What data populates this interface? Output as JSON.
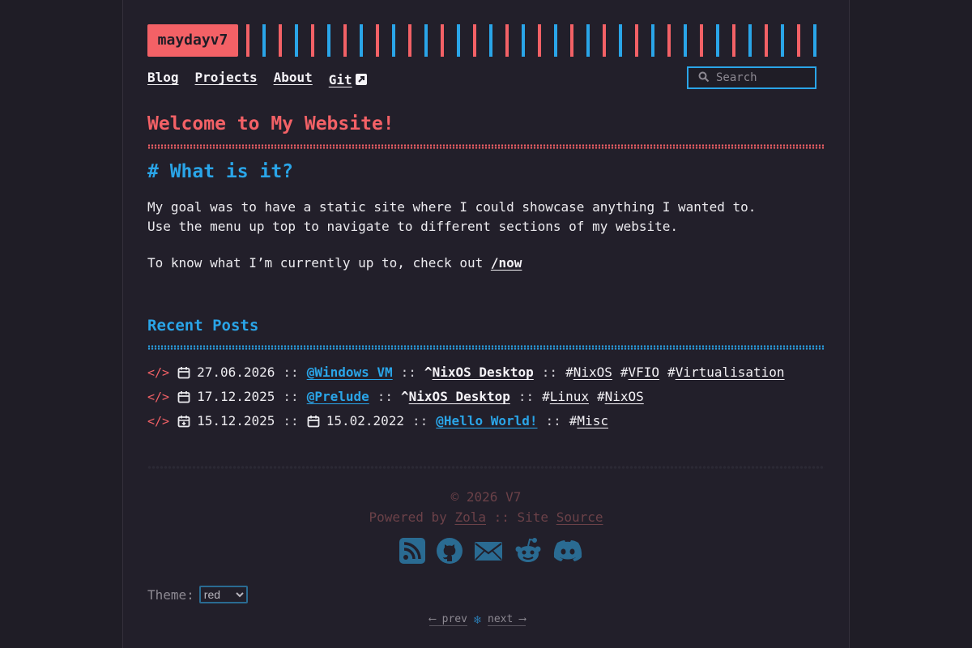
{
  "site": {
    "logo": "maydayv7"
  },
  "nav": {
    "items": [
      {
        "label": "Blog"
      },
      {
        "label": "Projects"
      },
      {
        "label": "About"
      },
      {
        "label": "Git"
      }
    ]
  },
  "search": {
    "placeholder": "Search"
  },
  "main": {
    "title": "Welcome to My Website!",
    "section_heading": "# What is it?",
    "para1_line1": "My goal was to have a static site where I could showcase anything I wanted to.",
    "para1_line2": "Use the menu up top to navigate to different sections of my website.",
    "para2_text": "To know what I’m currently up to, check out",
    "para2_link": "/now"
  },
  "recent": {
    "heading": "Recent Posts",
    "code_glyph": "</>",
    "sep": "::",
    "posts": [
      {
        "date": "27.06.2026",
        "title": "@Windows VM",
        "series": "NixOS Desktop",
        "tags": [
          "NixOS",
          "VFIO",
          "Virtualisation"
        ]
      },
      {
        "date": "17.12.2025",
        "title": "@Prelude",
        "series": "NixOS Desktop",
        "tags": [
          "Linux",
          "NixOS"
        ]
      },
      {
        "date": "15.12.2025",
        "updated": "15.02.2022",
        "title": "@Hello World!",
        "tags": [
          "Misc"
        ]
      }
    ]
  },
  "footer": {
    "copyright": "© 2026 V7",
    "powered_by": "Powered by",
    "zola": "Zola",
    "site": ":: Site",
    "source": "Source",
    "social_icons": [
      "rss-icon",
      "github-icon",
      "mail-icon",
      "reddit-icon",
      "discord-icon"
    ],
    "theme_label": "Theme:",
    "theme_value": "red",
    "prev": "⟵ prev",
    "snow": "❄",
    "next": "next ⟶"
  },
  "colors": {
    "red": "#f36166",
    "blue": "#2aa5e8",
    "bg": "#221f2a"
  }
}
